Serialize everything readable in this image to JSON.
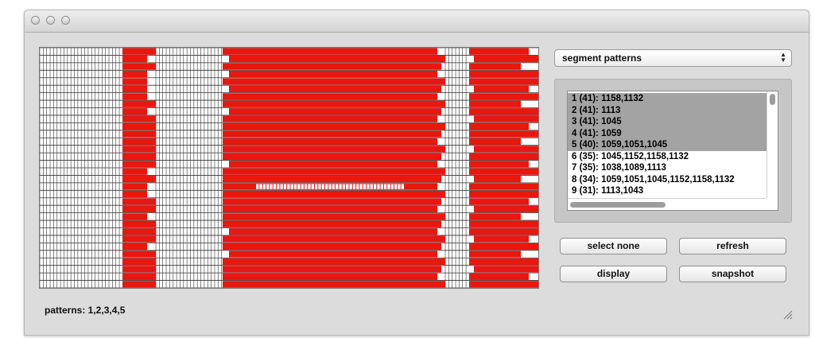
{
  "window": {
    "controls": [
      "close-button",
      "minimize-button",
      "zoom-button"
    ]
  },
  "grid": {
    "rows": 32,
    "columns": 61,
    "fill_color": "#e8170f",
    "empty_color": "#ffffff",
    "line_color": "#333333",
    "regions": [
      {
        "name": "blank-block-1",
        "col_start": 0,
        "col_end": 23,
        "state": "empty"
      },
      {
        "name": "red-band-1",
        "col_start": 24,
        "col_end": 33,
        "state": "filled",
        "notches": [
          1,
          3,
          4,
          5,
          6,
          8,
          16,
          18,
          19,
          22,
          26
        ]
      },
      {
        "name": "blank-block-2",
        "col_start": 34,
        "col_end": 52,
        "state": "empty"
      },
      {
        "name": "red-band-2",
        "col_start": 53,
        "col_end": 127,
        "state": "filled",
        "highlight_row": 18
      },
      {
        "name": "blank-block-3",
        "col_start": 128,
        "col_end": 135,
        "state": "empty"
      },
      {
        "name": "red-band-3",
        "col_start": 136,
        "col_end": 146,
        "state": "filled"
      }
    ]
  },
  "segment_select": {
    "selected": "segment patterns",
    "arrow_icon": "updown-arrows-icon"
  },
  "pattern_list": {
    "items": [
      {
        "label": "1 (41): 1158,1132",
        "selected": true
      },
      {
        "label": "2 (41): 1113",
        "selected": true
      },
      {
        "label": "3 (41): 1045",
        "selected": true
      },
      {
        "label": "4 (41): 1059",
        "selected": true
      },
      {
        "label": "5 (40): 1059,1051,1045",
        "selected": true
      },
      {
        "label": "6 (35): 1045,1152,1158,1132",
        "selected": false
      },
      {
        "label": "7 (35): 1038,1089,1113",
        "selected": false
      },
      {
        "label": "8 (34): 1059,1051,1045,1152,1158,1132",
        "selected": false
      },
      {
        "label": "9 (31): 1113,1043",
        "selected": false
      }
    ]
  },
  "buttons": {
    "select_none": "select none",
    "refresh": "refresh",
    "display": "display",
    "snapshot": "snapshot"
  },
  "status": {
    "text": "patterns: 1,2,3,4,5"
  },
  "colors": {
    "accent_red": "#e8170f",
    "selection_gray": "#a3a3a3",
    "window_bg": "#dcdcdc"
  }
}
